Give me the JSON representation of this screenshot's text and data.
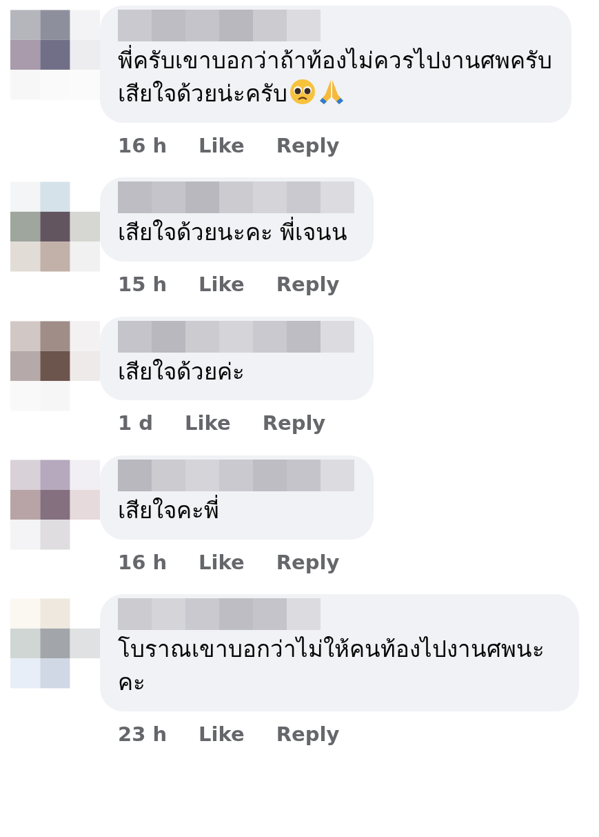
{
  "comments": [
    {
      "text": "พี่ครับเขาบอกว่าถ้าท้องไม่ควรไปงานศพครับ\nเสียใจด้วยน่ะครับ",
      "emoji": [
        {
          "kind": "pleading-face"
        },
        {
          "kind": "folded-hands"
        }
      ],
      "time": "16 h",
      "like": "Like",
      "reply": "Reply"
    },
    {
      "text": "เสียใจด้วยนะคะ พี่เจนน",
      "time": "15 h",
      "like": "Like",
      "reply": "Reply"
    },
    {
      "text": "เสียใจด้วยค่ะ",
      "time": "1 d",
      "like": "Like",
      "reply": "Reply"
    },
    {
      "text": "เสียใจคะพี่",
      "time": "16 h",
      "like": "Like",
      "reply": "Reply"
    },
    {
      "text": "โบราณเขาบอกว่าไม่ให้คนท้องไปงานศพนะคะ",
      "time": "23 h",
      "like": "Like",
      "reply": "Reply"
    }
  ]
}
